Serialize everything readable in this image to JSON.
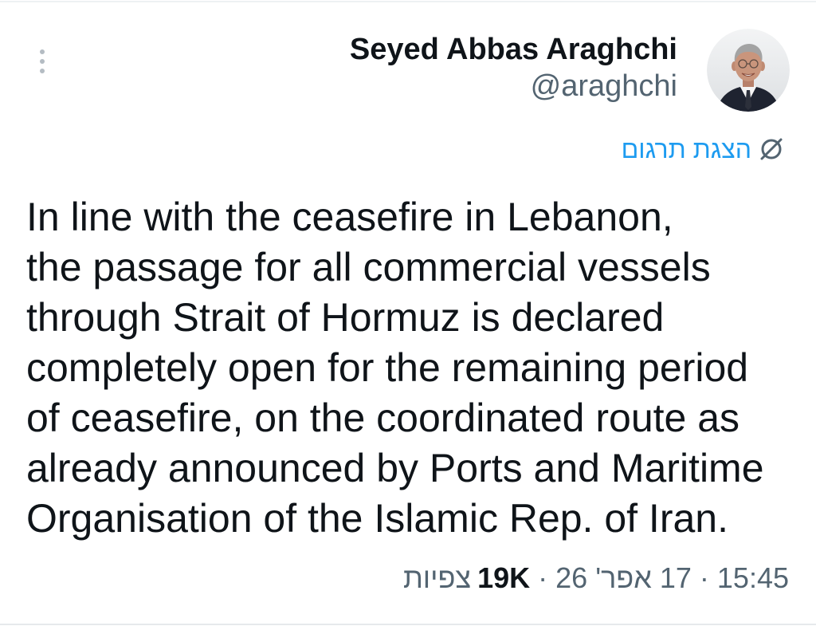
{
  "author": {
    "display_name": "Seyed Abbas Araghchi",
    "handle": "@araghchi",
    "avatar_icon": "profile-photo"
  },
  "more": {
    "icon": "more-vertical-icon"
  },
  "translate": {
    "label": "הצגת תרגום",
    "icon": "translate-icon"
  },
  "tweet": {
    "body_lines": [
      "In line with the ceasefire in Lebanon,",
      "the passage for all commercial vessels",
      "through Strait of Hormuz is declared",
      "completely open for the remaining period",
      "of ceasefire, on the coordinated route as",
      "already announced by Ports and Maritime",
      "Organisation of the Islamic Rep. of Iran."
    ]
  },
  "meta": {
    "time": "15:45",
    "separator": "·",
    "date": "17 אפר' 26",
    "views_count": "19K",
    "views_label": "צפיות"
  },
  "colors": {
    "text": "#0f1419",
    "secondary": "#536471",
    "link": "#1d9bf0"
  }
}
